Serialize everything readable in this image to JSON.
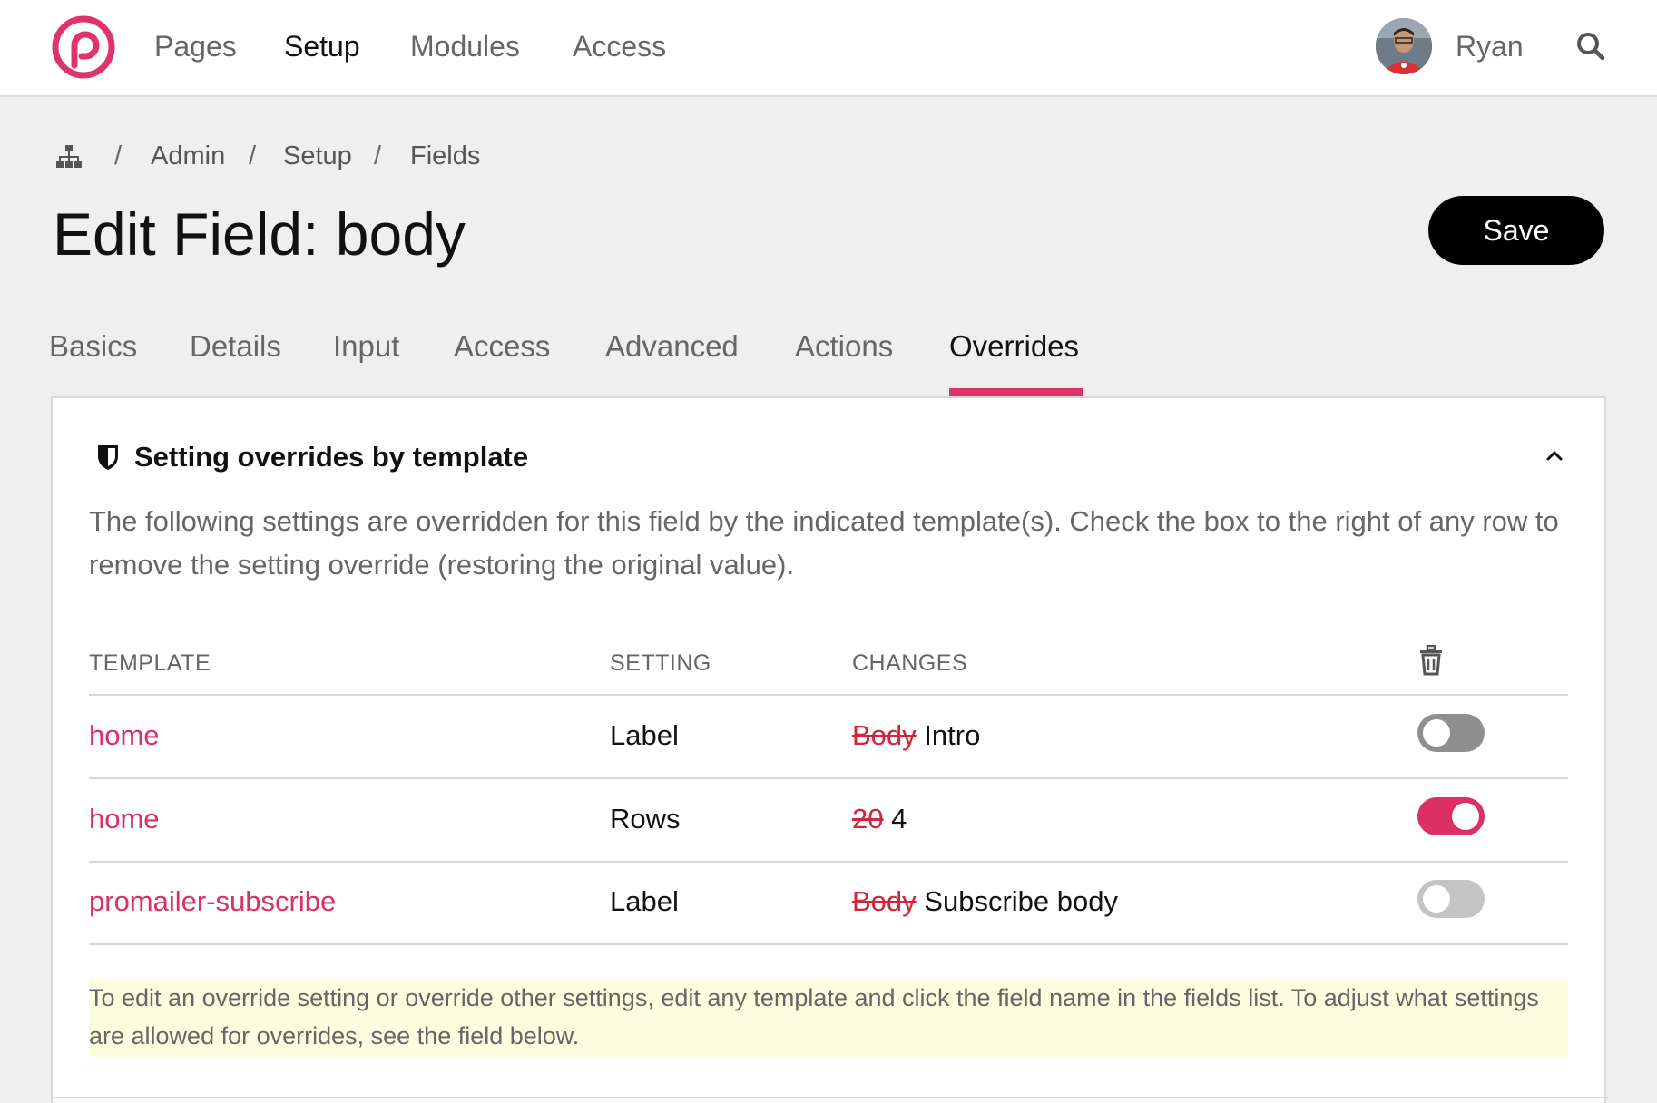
{
  "nav": {
    "items": [
      {
        "label": "Pages",
        "active": false
      },
      {
        "label": "Setup",
        "active": true
      },
      {
        "label": "Modules",
        "active": false
      },
      {
        "label": "Access",
        "active": false
      }
    ],
    "user_name": "Ryan"
  },
  "breadcrumb": {
    "items": [
      "Admin",
      "Setup",
      "Fields"
    ],
    "separator": "/"
  },
  "page": {
    "title": "Edit Field: body",
    "save_label": "Save"
  },
  "tabs": [
    {
      "label": "Basics",
      "active": false
    },
    {
      "label": "Details",
      "active": false
    },
    {
      "label": "Input",
      "active": false
    },
    {
      "label": "Access",
      "active": false
    },
    {
      "label": "Advanced",
      "active": false
    },
    {
      "label": "Actions",
      "active": false
    },
    {
      "label": "Overrides",
      "active": true
    }
  ],
  "panel": {
    "title": "Setting overrides by template",
    "description": "The following settings are overridden for this field by the indicated template(s). Check the box to the right of any row to remove the setting override (restoring the original value).",
    "columns": {
      "template": "TEMPLATE",
      "setting": "SETTING",
      "changes": "CHANGES"
    },
    "rows": [
      {
        "template": "home",
        "setting": "Label",
        "old_value": "Body",
        "new_value": "Intro",
        "remove": false
      },
      {
        "template": "home",
        "setting": "Rows",
        "old_value": "20",
        "new_value": "4",
        "remove": true
      },
      {
        "template": "promailer-subscribe",
        "setting": "Label",
        "old_value": "Body",
        "new_value": "Subscribe body",
        "remove": false
      }
    ],
    "note": "To edit an override setting or override other settings, edit any template and click the field name in the fields list. To adjust what settings are allowed for overrides, see the field below."
  },
  "colors": {
    "accent": "#dc2f63",
    "strike": "#d0253c",
    "note_bg": "#fdfde0",
    "save_bg": "#000000"
  }
}
